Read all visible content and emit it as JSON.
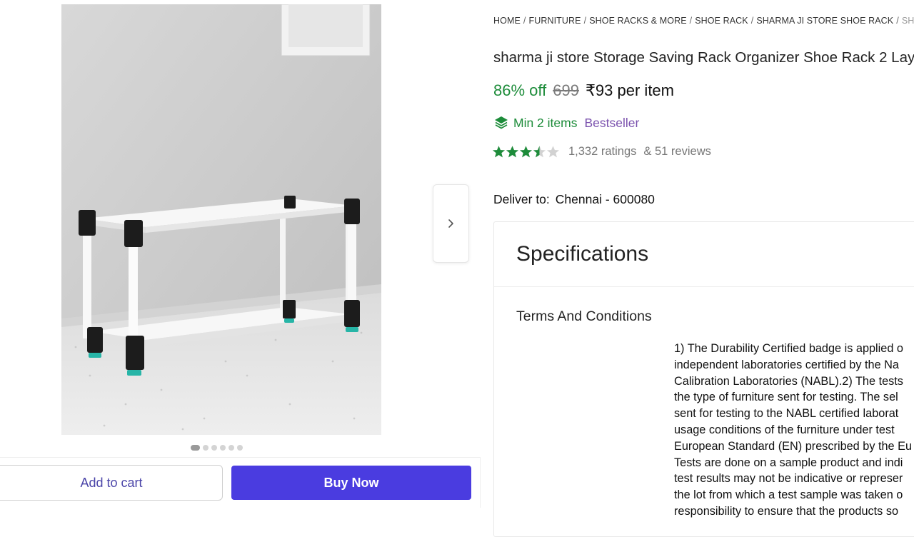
{
  "gallery": {
    "image_alt": "2-layer white and black shoe rack",
    "dot_count": 6,
    "active_dot": 0
  },
  "actions": {
    "add_to_cart": "Add to cart",
    "buy_now": "Buy Now"
  },
  "breadcrumb": {
    "items": [
      "HOME",
      "FURNITURE",
      "SHOE RACKS & MORE",
      "SHOE RACK",
      "SHARMA JI STORE SHOE RACK"
    ],
    "current": "SHARM"
  },
  "product": {
    "title": "sharma ji store Storage Saving Rack Organizer Shoe Rack 2 Lay",
    "discount": "86% off",
    "mrp": "699",
    "price": "₹93 per item",
    "min_items": "Min 2 items",
    "badge": "Bestseller",
    "rating_value": 3.5,
    "rating_max": 5,
    "ratings_count": "1,332 ratings",
    "reviews_count": "& 51 reviews"
  },
  "delivery": {
    "label": "Deliver to:",
    "location": "Chennai - 600080"
  },
  "specifications": {
    "heading": "Specifications",
    "subheading": "Terms And Conditions",
    "lines": [
      "1) The Durability Certified badge is applied o",
      "independent laboratories certified by the Na",
      "Calibration Laboratories (NABL).2) The tests",
      "the type of furniture sent for testing. The sel",
      "sent for testing to the NABL certified laborat",
      "usage conditions of the furniture under test",
      "European Standard (EN) prescribed by the Eu",
      "Tests are done on a sample product and indi",
      "test results may not be indicative or represer",
      "the lot from which a test sample was taken o",
      "responsibility to ensure that the products so"
    ]
  },
  "colors": {
    "discount": "#1d8c3a",
    "bestseller": "#7b52ae",
    "buy_button": "#4a3ce0",
    "cart_text": "#4a44a8",
    "star": "#1d8c3a"
  }
}
